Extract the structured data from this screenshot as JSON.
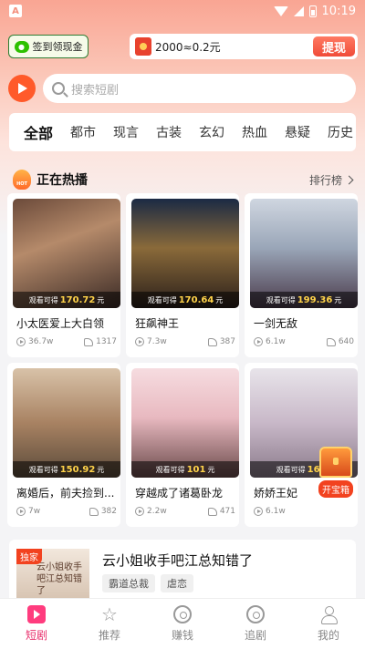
{
  "status_bar": {
    "badge": "A",
    "time": "10:19"
  },
  "header": {
    "signin_label": "签到领现金",
    "cash_text": "2000≈0.2元",
    "withdraw_label": "提现"
  },
  "search": {
    "placeholder": "搜索短剧"
  },
  "tabs": [
    {
      "label": "全部",
      "active": true
    },
    {
      "label": "都市"
    },
    {
      "label": "现言"
    },
    {
      "label": "古装"
    },
    {
      "label": "玄幻"
    },
    {
      "label": "热血"
    },
    {
      "label": "悬疑"
    },
    {
      "label": "历史"
    }
  ],
  "hot": {
    "title": "正在热播",
    "hot_badge": "HOT",
    "rank_label": "排行榜"
  },
  "cards": [
    {
      "title": "小太医爱上大白领",
      "earn_prefix": "观看可得",
      "earn_amount": "170.72",
      "earn_suffix": "元",
      "views": "36.7w",
      "shares": "1317",
      "bg": "linear-gradient(160deg,#6b4a3a 0%,#b58a6a 40%,#3a2a25 100%)"
    },
    {
      "title": "狂飙神王",
      "earn_prefix": "观看可得",
      "earn_amount": "170.64",
      "earn_suffix": "元",
      "views": "7.3w",
      "shares": "387",
      "bg": "linear-gradient(180deg,#1b2a44 0%,#8a6a3a 45%,#2a1f1a 100%)"
    },
    {
      "title": "一剑无敌",
      "earn_prefix": "观看可得",
      "earn_amount": "199.36",
      "earn_suffix": "元",
      "views": "6.1w",
      "shares": "640",
      "bg": "linear-gradient(180deg,#cfd6e0 0%,#9aa6b8 45%,#4a3a4a 100%)"
    },
    {
      "title": "离婚后，前夫捡到...",
      "earn_prefix": "观看可得",
      "earn_amount": "150.92",
      "earn_suffix": "元",
      "views": "7w",
      "shares": "382",
      "bg": "linear-gradient(180deg,#d8c2a8 0%,#a88262 50%,#5a4a3a 100%)"
    },
    {
      "title": "穿越成了诸葛卧龙",
      "earn_prefix": "观看可得",
      "earn_amount": "101",
      "earn_suffix": "元",
      "views": "2.2w",
      "shares": "471",
      "bg": "linear-gradient(180deg,#f6dce0 0%,#e8b9c0 45%,#6a4a4a 100%)"
    },
    {
      "title": "娇娇王妃",
      "earn_prefix": "观看可得",
      "earn_amount": "168.",
      "earn_suffix": "",
      "views": "6.1w",
      "shares": "",
      "bg": "linear-gradient(180deg,#e8e4ea 0%,#c8b8c8 50%,#8a7a8a 100%)"
    }
  ],
  "treasure": {
    "label": "开宝箱"
  },
  "feature": {
    "badge": "独家",
    "poster_text": "云小姐收手吧江总知错了",
    "title": "云小姐收手吧江总知错了",
    "tags": [
      "霸道总裁",
      "虐恋"
    ]
  },
  "nav": [
    {
      "label": "短剧",
      "icon": "drama-icon",
      "active": true
    },
    {
      "label": "推荐",
      "icon": "star-icon"
    },
    {
      "label": "赚钱",
      "icon": "coin-icon"
    },
    {
      "label": "追剧",
      "icon": "follow-icon"
    },
    {
      "label": "我的",
      "icon": "user-icon"
    }
  ],
  "colors": {
    "accent": "#e8306c",
    "withdraw": "#f04b38",
    "earn": "#ffd34a",
    "header_bg": "#f9a593"
  }
}
